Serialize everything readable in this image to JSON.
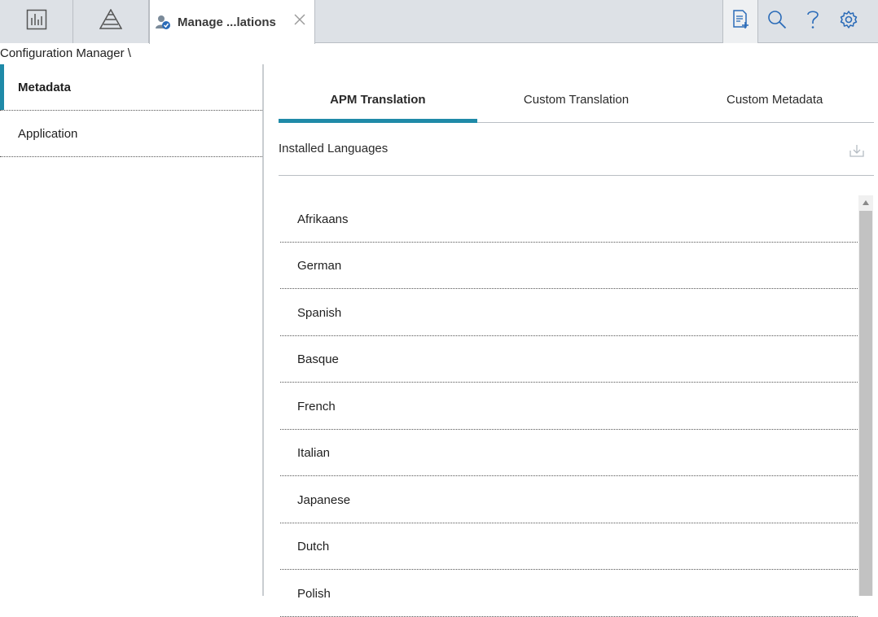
{
  "topbar": {
    "icon_tabs": [
      "dashboard-icon",
      "pyramid-icon"
    ],
    "active_tab": {
      "label": "Manage ...lations",
      "icon": "user-translation-icon"
    },
    "tools": [
      "report-add-icon",
      "search-icon",
      "help-icon",
      "settings-icon"
    ]
  },
  "breadcrumb": "Configuration Manager \\",
  "sidebar": {
    "items": [
      {
        "label": "Metadata",
        "active": true
      },
      {
        "label": "Application",
        "active": false
      }
    ]
  },
  "main": {
    "tabs": [
      {
        "label": "APM Translation",
        "active": true
      },
      {
        "label": "Custom Translation",
        "active": false
      },
      {
        "label": "Custom Metadata",
        "active": false
      }
    ],
    "section_title": "Installed Languages",
    "languages": [
      "Afrikaans",
      "German",
      "Spanish",
      "Basque",
      "French",
      "Italian",
      "Japanese",
      "Dutch",
      "Polish"
    ]
  },
  "colors": {
    "accent": "#1f8aa8",
    "topbar_bg": "#dde1e6",
    "icon_blue": "#2a6bb8"
  }
}
